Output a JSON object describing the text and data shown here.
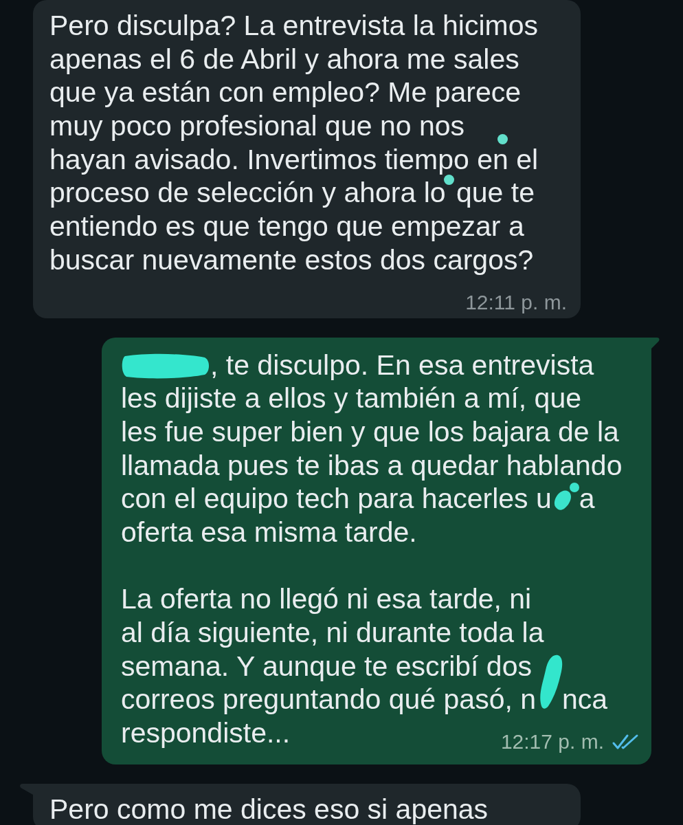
{
  "messages": [
    {
      "kind": "incoming",
      "tail": false,
      "paragraphs": [
        [
          [
            {
              "kind": "text",
              "text": "Pero disculpa? La entrevista la hicimos"
            }
          ],
          [
            {
              "kind": "text",
              "text": "apenas el 6 de Abril y ahora me sales"
            }
          ],
          [
            {
              "kind": "text",
              "text": "que ya están con empleo? Me parece"
            }
          ],
          [
            {
              "kind": "text",
              "text": "muy poco profesional que no nos"
            },
            {
              "kind": "dot"
            }
          ],
          [
            {
              "kind": "text",
              "text": "hayan avisado. Invertimos tiempo en el"
            }
          ],
          [
            {
              "kind": "text",
              "text": "proceso de selección y ahora lo"
            },
            {
              "kind": "dot"
            },
            {
              "kind": "text",
              "text": " que te"
            }
          ],
          [
            {
              "kind": "text",
              "text": "entiendo es que tengo que empezar a"
            }
          ],
          [
            {
              "kind": "text",
              "text": "buscar nuevamente estos dos cargos?"
            }
          ]
        ]
      ],
      "time": "12:11 p. m."
    },
    {
      "kind": "outgoing",
      "tail": true,
      "paragraphs": [
        [
          [
            {
              "kind": "blob"
            },
            {
              "kind": "text",
              "text": ", te disculpo. En esa entrevista"
            }
          ],
          [
            {
              "kind": "text",
              "text": "les dijiste a ellos y también a mí, que"
            }
          ],
          [
            {
              "kind": "text",
              "text": "les fue super bien y que los bajara de la"
            }
          ],
          [
            {
              "kind": "text",
              "text": "llamada pues te ibas a quedar hablando"
            }
          ],
          [
            {
              "kind": "text",
              "text": "con el equipo tech para hacerles u"
            },
            {
              "kind": "smudge"
            },
            {
              "kind": "text",
              "text": "a"
            }
          ],
          [
            {
              "kind": "text",
              "text": "oferta esa misma tarde."
            }
          ]
        ],
        [
          [
            {
              "kind": "text",
              "text": "La oferta no llegó ni esa tarde, ni"
            }
          ],
          [
            {
              "kind": "text",
              "text": "al día siguiente, ni durante toda la"
            }
          ],
          [
            {
              "kind": "text",
              "text": "semana. Y aunque te escribí dos"
            }
          ],
          [
            {
              "kind": "text",
              "text": "correos preguntando qué pasó, n"
            },
            {
              "kind": "stroke"
            },
            {
              "kind": "text",
              "text": "nca"
            }
          ],
          [
            {
              "kind": "text",
              "text": "respondiste..."
            }
          ]
        ]
      ],
      "time": "12:17 p. m.",
      "read": true
    },
    {
      "kind": "incoming",
      "tail": true,
      "paragraphs": [
        [
          [
            {
              "kind": "text",
              "text": "Pero como me dices eso si apenas"
            }
          ]
        ]
      ]
    }
  ]
}
